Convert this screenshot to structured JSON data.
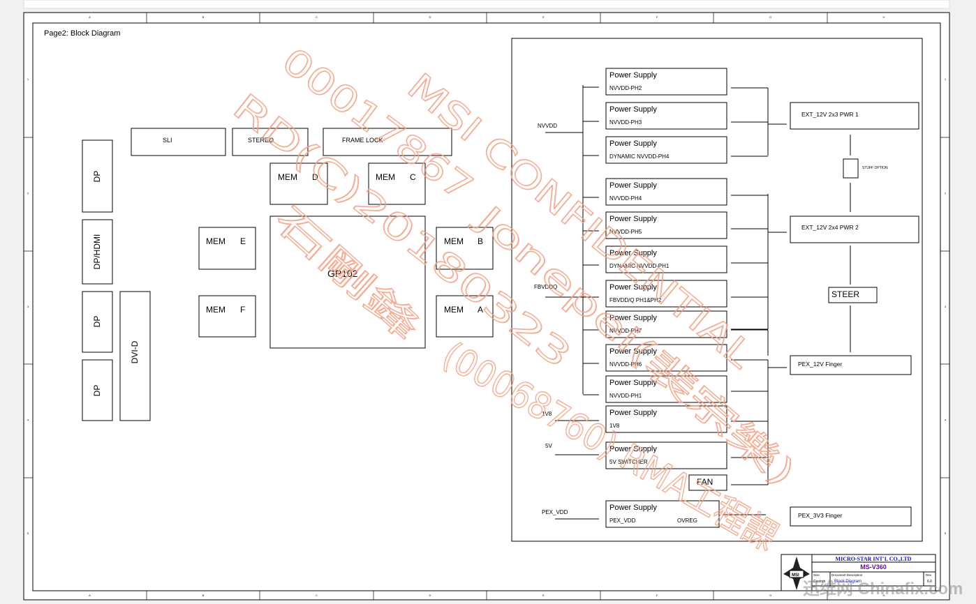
{
  "page_title": "Page2: Block Diagram",
  "border": {
    "columns": [
      "A",
      "B",
      "C",
      "D",
      "E",
      "F",
      "G",
      "H"
    ],
    "rows": [
      "1",
      "2",
      "3",
      "4",
      "5"
    ]
  },
  "left_blocks": {
    "dp1": "DP",
    "dp_hdmi": "DP/HDMI",
    "dp2": "DP",
    "dp3": "DP",
    "dvi": "DVI-D",
    "sli": "SLI",
    "stereo": "STEREO",
    "frame_lock": "FRAME LOCK",
    "mem_d": [
      "MEM",
      "D"
    ],
    "mem_c": [
      "MEM",
      "C"
    ],
    "mem_e": [
      "MEM",
      "E"
    ],
    "mem_f": [
      "MEM",
      "F"
    ],
    "mem_b": [
      "MEM",
      "B"
    ],
    "mem_a": [
      "MEM",
      "A"
    ],
    "gpu": "GP102"
  },
  "power": {
    "inputs": {
      "nvvdd": "NVVDD",
      "fbvddq": "FBVDDQ",
      "v1v8": "1V8",
      "v5": "5V",
      "pex_vdd": "PEX_VDD"
    },
    "supplies": [
      {
        "title": "Power Supply",
        "sub": "NVVDD-PH2"
      },
      {
        "title": "Power Supply",
        "sub": "NVVDD-PH3"
      },
      {
        "title": "Power Supply",
        "sub": "DYNAMIC NVVDD-PH4"
      },
      {
        "title": "Power Supply",
        "sub": "NVVDD-PH4"
      },
      {
        "title": "Power Supply",
        "sub": "NVVDD-PH5"
      },
      {
        "title": "Power Supply",
        "sub": "DYNAMIC NVVDD-PH1"
      },
      {
        "title": "Power Supply",
        "sub": "FBVDD/Q PH1&PH2"
      },
      {
        "title": "Power Supply",
        "sub": "NVVDD-PH7"
      },
      {
        "title": "Power Supply",
        "sub": "NVVDD-PH6"
      },
      {
        "title": "Power Supply",
        "sub": "NVVDD-PH1"
      },
      {
        "title": "Power Supply",
        "sub": "1V8"
      },
      {
        "title": "Power Supply",
        "sub": "5V SWITCHER"
      }
    ],
    "pex_supply": {
      "title": "Power Supply",
      "sub": "PEX_VDD",
      "extra": "OVREG"
    },
    "fan": "FAN",
    "ext1": "EXT_12V 2x3 PWR 1",
    "ext2": "EXT_12V 2x4 PWR 2",
    "stuff_option": "STUFF OPTION",
    "steer": "STEER",
    "pex_12v": "PEX_12V Finger",
    "pex_3v3": "PEX_3V3 Finger"
  },
  "title_block": {
    "company": "MICRO-STAR INT'L CO.,LTD",
    "model": "MS-V360",
    "size_label": "Size",
    "size_value": "Custom",
    "doc_label": "Document  Description",
    "doc_value": "Block Diagram",
    "rev_label": "Rev",
    "rev_value": "6.0",
    "logo_text": "MSI"
  },
  "watermark": {
    "lines": [
      "00017867",
      "RD(C)20180323",
      "石剛鋒",
      "MSI CONFIDENTIAL",
      "Jonepei(裴宗樂)",
      "(00068760) RMA工程課"
    ]
  },
  "overlay_watermark": "迅维网 Chinafix.com",
  "colors": {
    "line": "#000000",
    "watermark": "#f4a184",
    "company_text": "#1010c0",
    "model_text": "#5a1090"
  }
}
